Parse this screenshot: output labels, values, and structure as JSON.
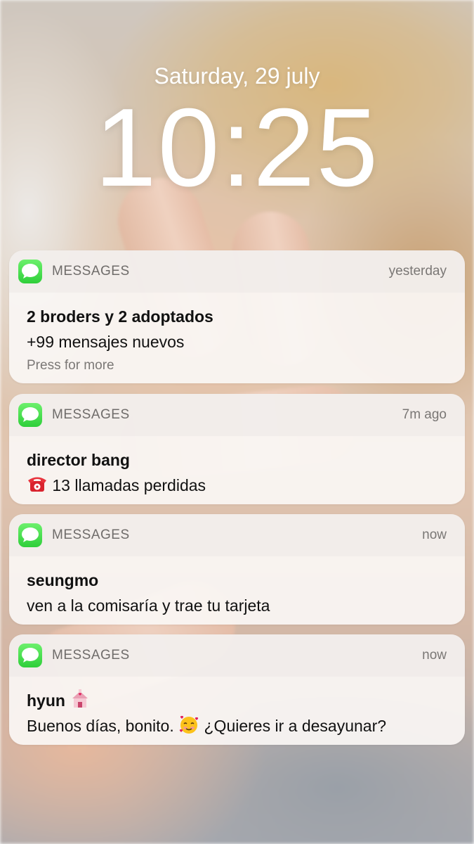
{
  "lock_screen": {
    "date": "Saturday, 29 july",
    "time": "10:25"
  },
  "notifications": [
    {
      "app": "MESSAGES",
      "time": "yesterday",
      "title": "2 broders y 2 adoptados",
      "text": "+99 mensajes nuevos",
      "more": "Press for more"
    },
    {
      "app": "MESSAGES",
      "time": "7m ago",
      "title": "director bang",
      "text_emoji": "telephone-icon",
      "text": "13 llamadas perdidas"
    },
    {
      "app": "MESSAGES",
      "time": "now",
      "title": "seungmo",
      "text": "ven a la comisaría y trae tu tarjeta"
    },
    {
      "app": "MESSAGES",
      "time": "now",
      "title": "hyun",
      "title_emoji": "wedding-chapel-icon",
      "text_before": "Buenos días, bonito.",
      "text_emoji": "smiling-face-with-hearts-icon",
      "text_after": "¿Quieres ir a desayunar?"
    }
  ],
  "colors": {
    "messages_icon": "#34d03f",
    "card_bg": "#faf6f4"
  }
}
